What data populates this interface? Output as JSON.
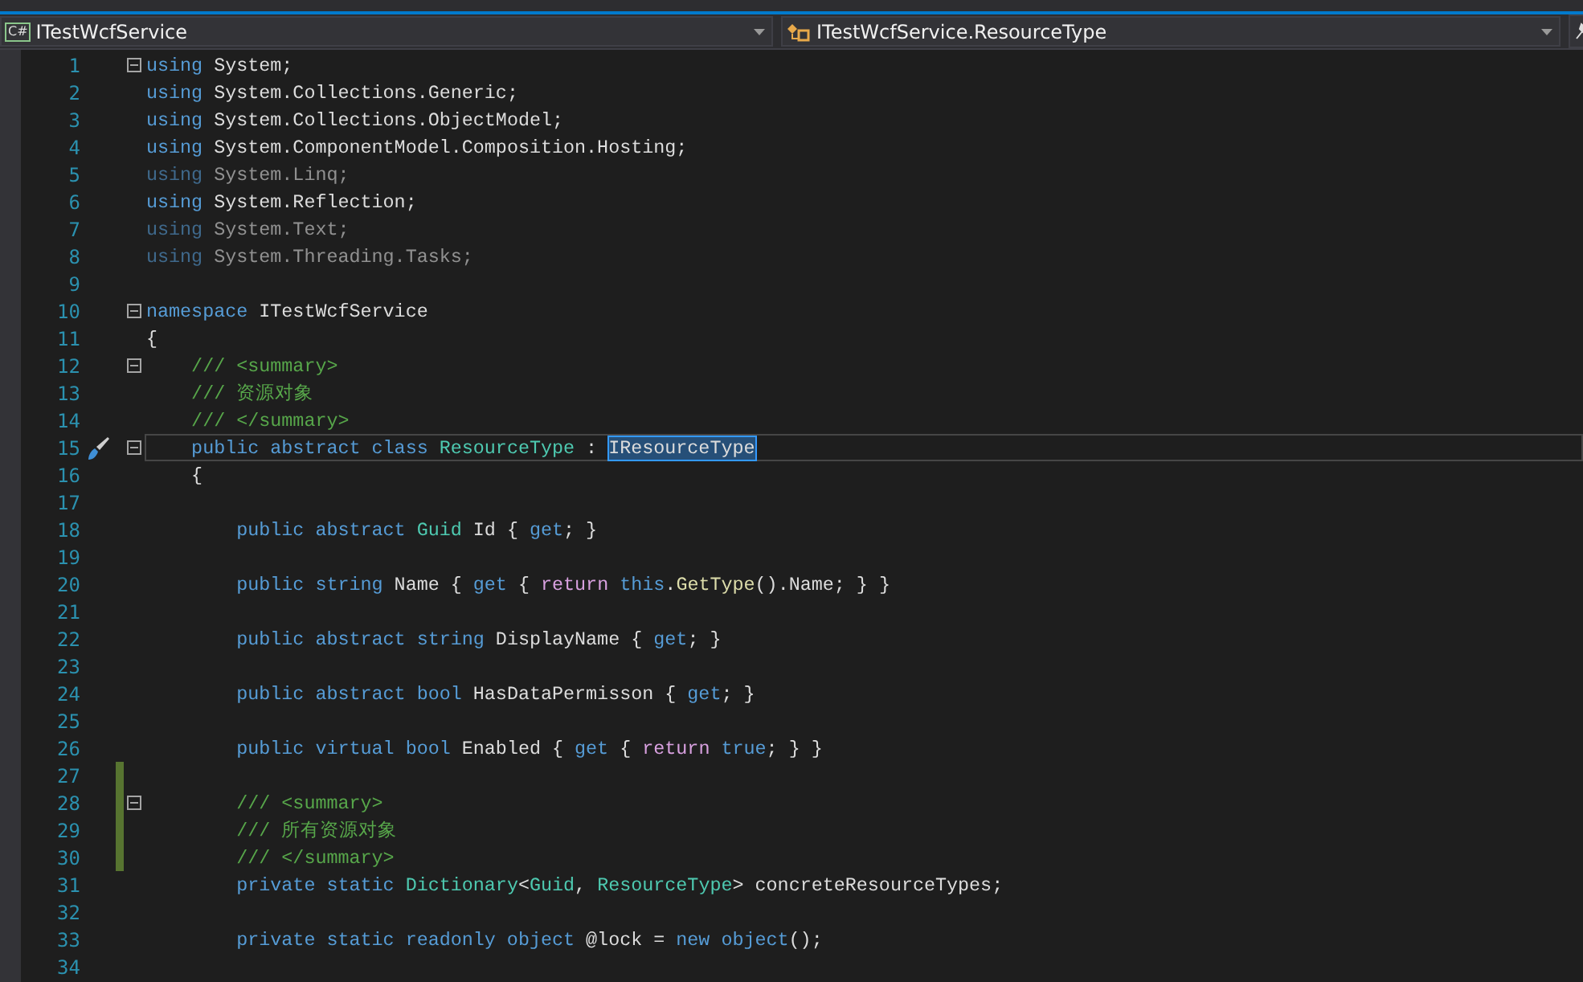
{
  "navigation_bar": {
    "project_icon": "C#",
    "project": "ITestWcfService",
    "member": "ITestWcfService.ResourceType"
  },
  "editor": {
    "lines": [
      {
        "number": "1",
        "fold": true,
        "tokens": [
          {
            "kind": "keyword",
            "text": "using"
          },
          {
            "kind": "plain",
            "text": " System;"
          }
        ]
      },
      {
        "number": "2",
        "tokens": [
          {
            "kind": "keyword",
            "text": "using"
          },
          {
            "kind": "plain",
            "text": " System.Collections.Generic;"
          }
        ]
      },
      {
        "number": "3",
        "tokens": [
          {
            "kind": "keyword",
            "text": "using"
          },
          {
            "kind": "plain",
            "text": " System.Collections.ObjectModel;"
          }
        ]
      },
      {
        "number": "4",
        "tokens": [
          {
            "kind": "keyword",
            "text": "using"
          },
          {
            "kind": "plain",
            "text": " System.ComponentModel.Composition.Hosting;"
          }
        ]
      },
      {
        "number": "5",
        "faded": true,
        "tokens": [
          {
            "kind": "keyword",
            "text": "using"
          },
          {
            "kind": "plain",
            "text": " System.Linq;"
          }
        ]
      },
      {
        "number": "6",
        "tokens": [
          {
            "kind": "keyword",
            "text": "using"
          },
          {
            "kind": "plain",
            "text": " System.Reflection;"
          }
        ]
      },
      {
        "number": "7",
        "faded": true,
        "tokens": [
          {
            "kind": "keyword",
            "text": "using"
          },
          {
            "kind": "plain",
            "text": " System.Text;"
          }
        ]
      },
      {
        "number": "8",
        "faded": true,
        "tokens": [
          {
            "kind": "keyword",
            "text": "using"
          },
          {
            "kind": "plain",
            "text": " System.Threading.Tasks;"
          }
        ]
      },
      {
        "number": "9"
      },
      {
        "number": "10",
        "fold": true,
        "tokens": [
          {
            "kind": "keyword",
            "text": "namespace"
          },
          {
            "kind": "plain",
            "text": " ITestWcfService"
          }
        ]
      },
      {
        "number": "11",
        "tokens": [
          {
            "kind": "plain",
            "text": "{"
          }
        ]
      },
      {
        "number": "12",
        "fold": true,
        "tokens": [
          {
            "kind": "comment",
            "text": "    /// <summary>"
          }
        ]
      },
      {
        "number": "13",
        "tokens": [
          {
            "kind": "comment",
            "text": "    /// 资源对象"
          }
        ]
      },
      {
        "number": "14",
        "tokens": [
          {
            "kind": "comment",
            "text": "    /// </summary>"
          }
        ]
      },
      {
        "number": "15",
        "fold": true,
        "current": true,
        "tokens": [
          {
            "kind": "keyword",
            "text": "    public abstract class "
          },
          {
            "kind": "type",
            "text": "ResourceType"
          },
          {
            "kind": "plain",
            "text": " : "
          },
          {
            "kind": "highlight",
            "text": "IResourceType"
          }
        ]
      },
      {
        "number": "16",
        "tokens": [
          {
            "kind": "plain",
            "text": "    {"
          }
        ]
      },
      {
        "number": "17"
      },
      {
        "number": "18",
        "tokens": [
          {
            "kind": "keyword",
            "text": "        public abstract "
          },
          {
            "kind": "type",
            "text": "Guid"
          },
          {
            "kind": "plain",
            "text": " Id { "
          },
          {
            "kind": "keyword",
            "text": "get"
          },
          {
            "kind": "plain",
            "text": "; }"
          }
        ]
      },
      {
        "number": "19"
      },
      {
        "number": "20",
        "tokens": [
          {
            "kind": "keyword",
            "text": "        public string"
          },
          {
            "kind": "plain",
            "text": " Name { "
          },
          {
            "kind": "keyword",
            "text": "get"
          },
          {
            "kind": "plain",
            "text": " { "
          },
          {
            "kind": "control",
            "text": "return "
          },
          {
            "kind": "keyword",
            "text": "this"
          },
          {
            "kind": "plain",
            "text": "."
          },
          {
            "kind": "method",
            "text": "GetType"
          },
          {
            "kind": "plain",
            "text": "().Name; } }"
          }
        ]
      },
      {
        "number": "21"
      },
      {
        "number": "22",
        "tokens": [
          {
            "kind": "keyword",
            "text": "        public abstract string"
          },
          {
            "kind": "plain",
            "text": " DisplayName { "
          },
          {
            "kind": "keyword",
            "text": "get"
          },
          {
            "kind": "plain",
            "text": "; }"
          }
        ]
      },
      {
        "number": "23"
      },
      {
        "number": "24",
        "tokens": [
          {
            "kind": "keyword",
            "text": "        public abstract bool"
          },
          {
            "kind": "plain",
            "text": " HasDataPermisson { "
          },
          {
            "kind": "keyword",
            "text": "get"
          },
          {
            "kind": "plain",
            "text": "; }"
          }
        ]
      },
      {
        "number": "25"
      },
      {
        "number": "26",
        "tokens": [
          {
            "kind": "keyword",
            "text": "        public virtual bool"
          },
          {
            "kind": "plain",
            "text": " Enabled { "
          },
          {
            "kind": "keyword",
            "text": "get"
          },
          {
            "kind": "plain",
            "text": " { "
          },
          {
            "kind": "control",
            "text": "return "
          },
          {
            "kind": "keyword",
            "text": "true"
          },
          {
            "kind": "plain",
            "text": "; } }"
          }
        ]
      },
      {
        "number": "27",
        "changed": true
      },
      {
        "number": "28",
        "fold": true,
        "changed": true,
        "tokens": [
          {
            "kind": "comment",
            "text": "        /// <summary>"
          }
        ]
      },
      {
        "number": "29",
        "changed": true,
        "tokens": [
          {
            "kind": "comment",
            "text": "        /// 所有资源对象"
          }
        ]
      },
      {
        "number": "30",
        "changed": true,
        "tokens": [
          {
            "kind": "comment",
            "text": "        /// </summary>"
          }
        ]
      },
      {
        "number": "31",
        "tokens": [
          {
            "kind": "keyword",
            "text": "        private static "
          },
          {
            "kind": "type",
            "text": "Dictionary"
          },
          {
            "kind": "plain",
            "text": "<"
          },
          {
            "kind": "type",
            "text": "Guid"
          },
          {
            "kind": "plain",
            "text": ", "
          },
          {
            "kind": "type",
            "text": "ResourceType"
          },
          {
            "kind": "plain",
            "text": "> concreteResourceTypes;"
          }
        ]
      },
      {
        "number": "32"
      },
      {
        "number": "33",
        "tokens": [
          {
            "kind": "keyword",
            "text": "        private static readonly object"
          },
          {
            "kind": "plain",
            "text": " @lock = "
          },
          {
            "kind": "keyword",
            "text": "new object"
          },
          {
            "kind": "plain",
            "text": "();"
          }
        ]
      },
      {
        "number": "34"
      }
    ]
  }
}
